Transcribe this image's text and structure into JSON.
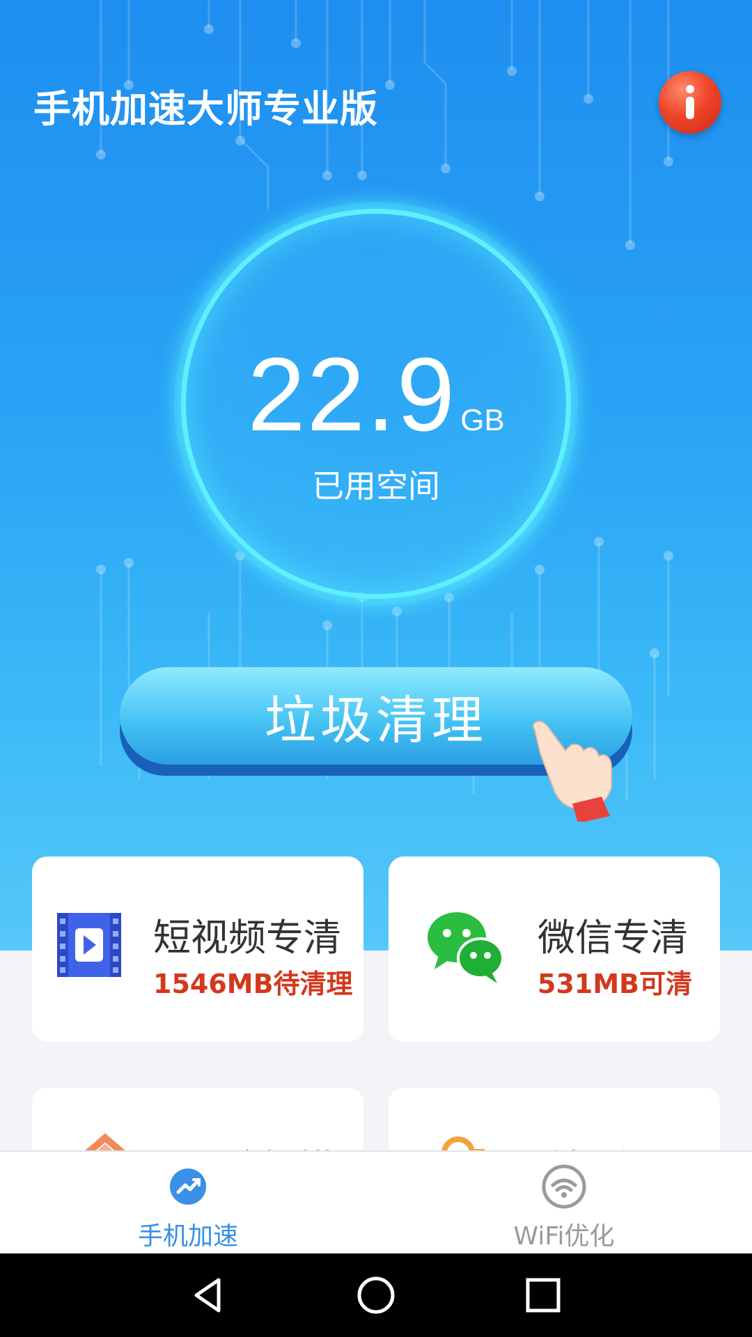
{
  "header": {
    "title": "手机加速大师专业版"
  },
  "storage": {
    "value": "22.9",
    "unit": "GB",
    "label": "已用空间"
  },
  "main_button": {
    "label": "垃圾清理"
  },
  "cards": [
    {
      "title": "短视频专清",
      "subtitle": "1546MB待清理",
      "icon": "video-icon"
    },
    {
      "title": "微信专清",
      "subtitle": "531MB可清",
      "icon": "wechat-icon"
    },
    {
      "title": "风险扫描",
      "icon": "shield-icon"
    },
    {
      "title": "手机降温",
      "icon": "thermometer-icon"
    }
  ],
  "tabs": [
    {
      "label": "手机加速",
      "icon": "speed-icon",
      "active": true,
      "color": "#3a8fe6"
    },
    {
      "label": "WiFi优化",
      "icon": "wifi-icon",
      "active": false,
      "color": "#9a9a9a"
    }
  ],
  "colors": {
    "accent": "#3a8fe6",
    "warning": "#d3381c",
    "info_button": "#e8412a"
  }
}
